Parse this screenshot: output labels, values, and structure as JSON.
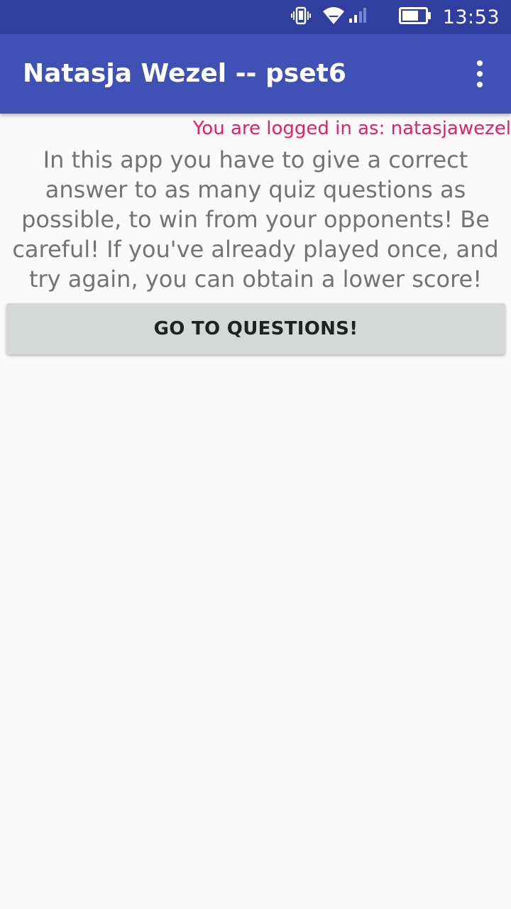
{
  "status_bar": {
    "time": "13:53",
    "icons": [
      "vibrate-icon",
      "wifi-icon",
      "signal-icon",
      "battery-icon"
    ]
  },
  "app_bar": {
    "title": "Natasja Wezel -- pset6",
    "menu_icon": "overflow-menu-icon"
  },
  "main": {
    "logged_in_text": "You are logged in as: natasjawezel",
    "intro_text": "In this app you have to give a correct answer to as many quiz questions as possible, to win from your opponents! Be careful! If you've already played once, and try again, you can obtain a lower score!",
    "go_button_label": "GO TO QUESTIONS!"
  },
  "colors": {
    "status_bar": "#303f9f",
    "app_bar": "#3f51b5",
    "accent": "#e91e63",
    "background": "#fafafa",
    "body_text": "#737373",
    "button_bg": "#d6d7d7"
  }
}
